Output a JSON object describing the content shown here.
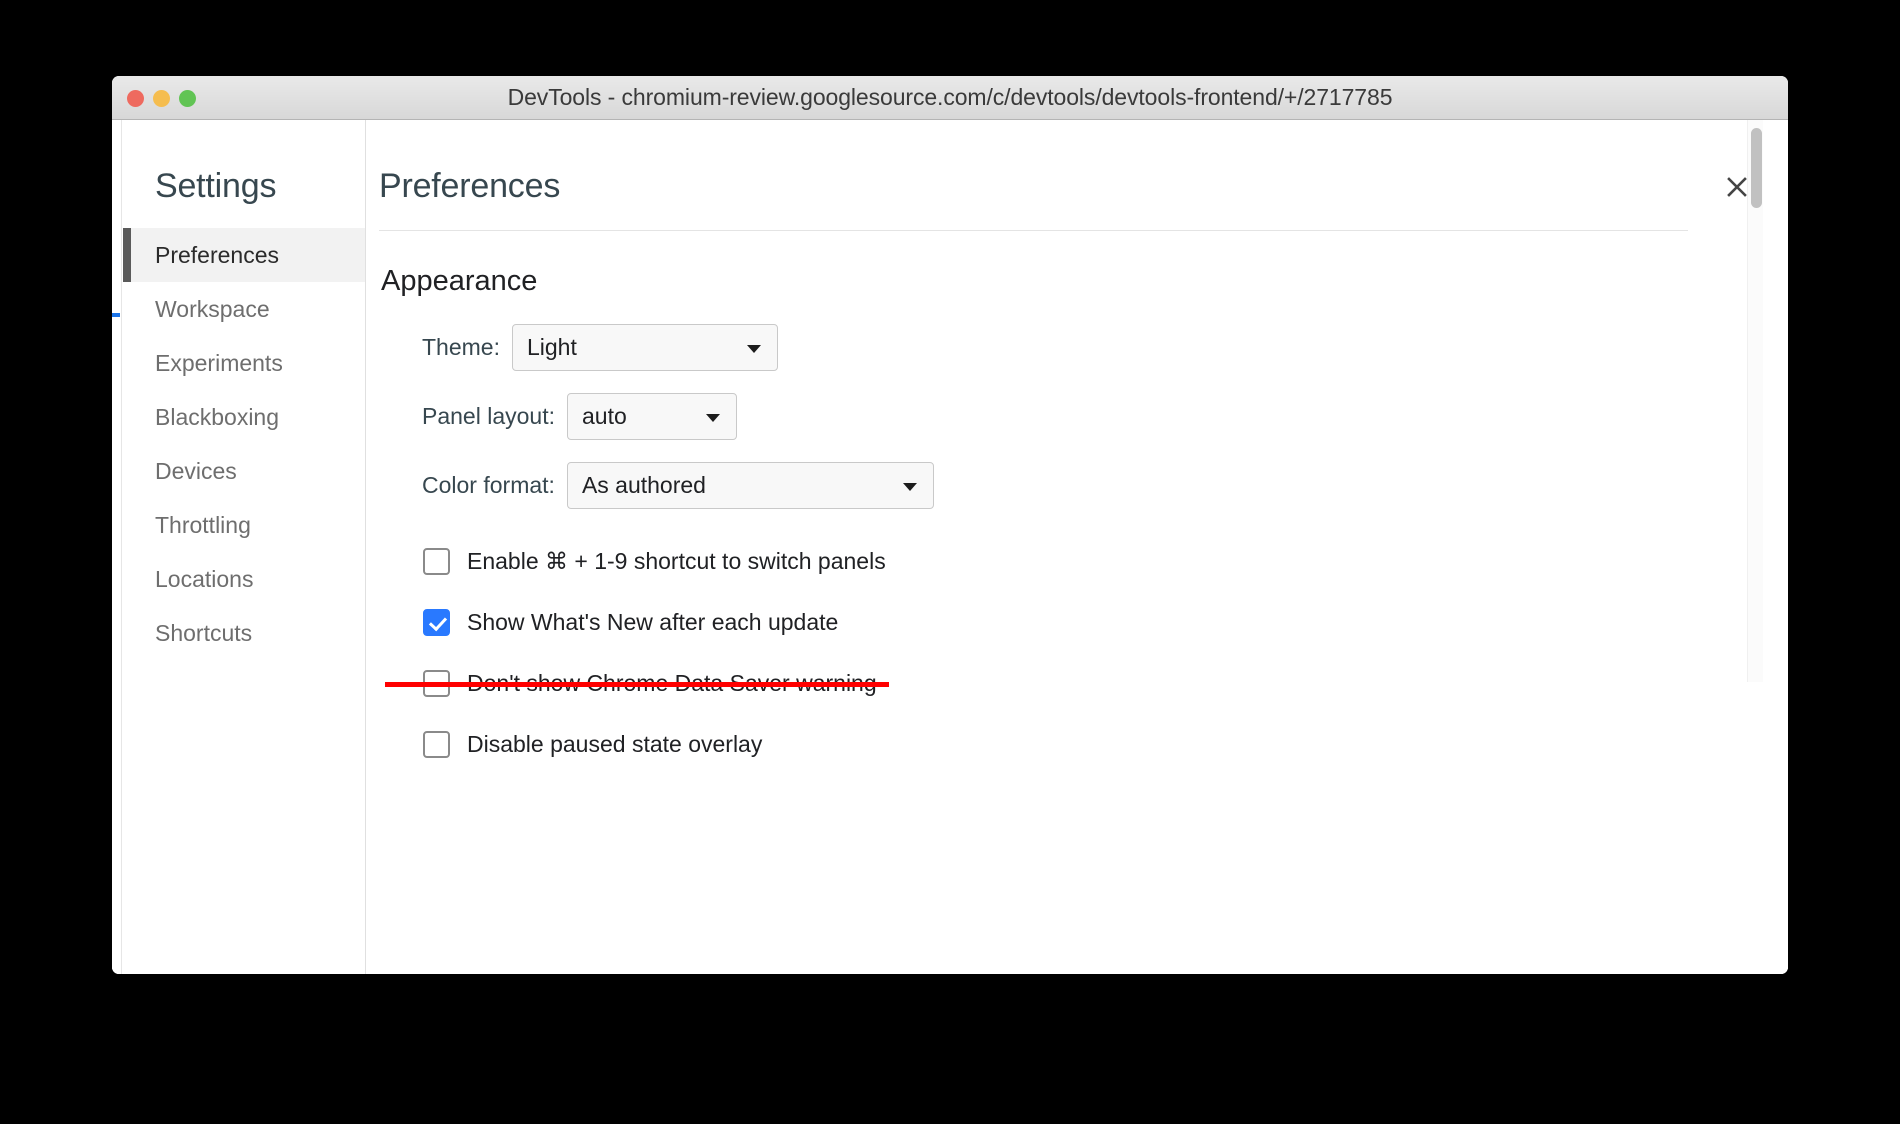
{
  "window": {
    "title": "DevTools - chromium-review.googlesource.com/c/devtools/devtools-frontend/+/2717785",
    "traffic_lights": {
      "close": "close-window",
      "minimize": "minimize-window",
      "zoom": "zoom-window"
    }
  },
  "dialog": {
    "close_label": "×",
    "sidebar": {
      "title": "Settings",
      "items": [
        {
          "label": "Preferences",
          "selected": true
        },
        {
          "label": "Workspace",
          "selected": false
        },
        {
          "label": "Experiments",
          "selected": false
        },
        {
          "label": "Blackboxing",
          "selected": false
        },
        {
          "label": "Devices",
          "selected": false
        },
        {
          "label": "Throttling",
          "selected": false
        },
        {
          "label": "Locations",
          "selected": false
        },
        {
          "label": "Shortcuts",
          "selected": false
        }
      ]
    },
    "main": {
      "title": "Preferences",
      "section_title": "Appearance",
      "selects": [
        {
          "label": "Theme:",
          "value": "Light"
        },
        {
          "label": "Panel layout:",
          "value": "auto"
        },
        {
          "label": "Color format:",
          "value": "As authored"
        }
      ],
      "checkboxes": [
        {
          "label": "Enable ⌘ + 1-9 shortcut to switch panels",
          "checked": false,
          "struck": false
        },
        {
          "label": "Show What's New after each update",
          "checked": true,
          "struck": false
        },
        {
          "label": "Don't show Chrome Data Saver warning",
          "checked": false,
          "struck": true
        },
        {
          "label": "Disable paused state overlay",
          "checked": false,
          "struck": false
        }
      ]
    }
  },
  "colors": {
    "accent_blue": "#2979ff",
    "strike_red": "#ff0000",
    "selected_bar": "#5a5a5a",
    "selected_bg": "#f2f2f2",
    "title_text": "#37474f"
  }
}
